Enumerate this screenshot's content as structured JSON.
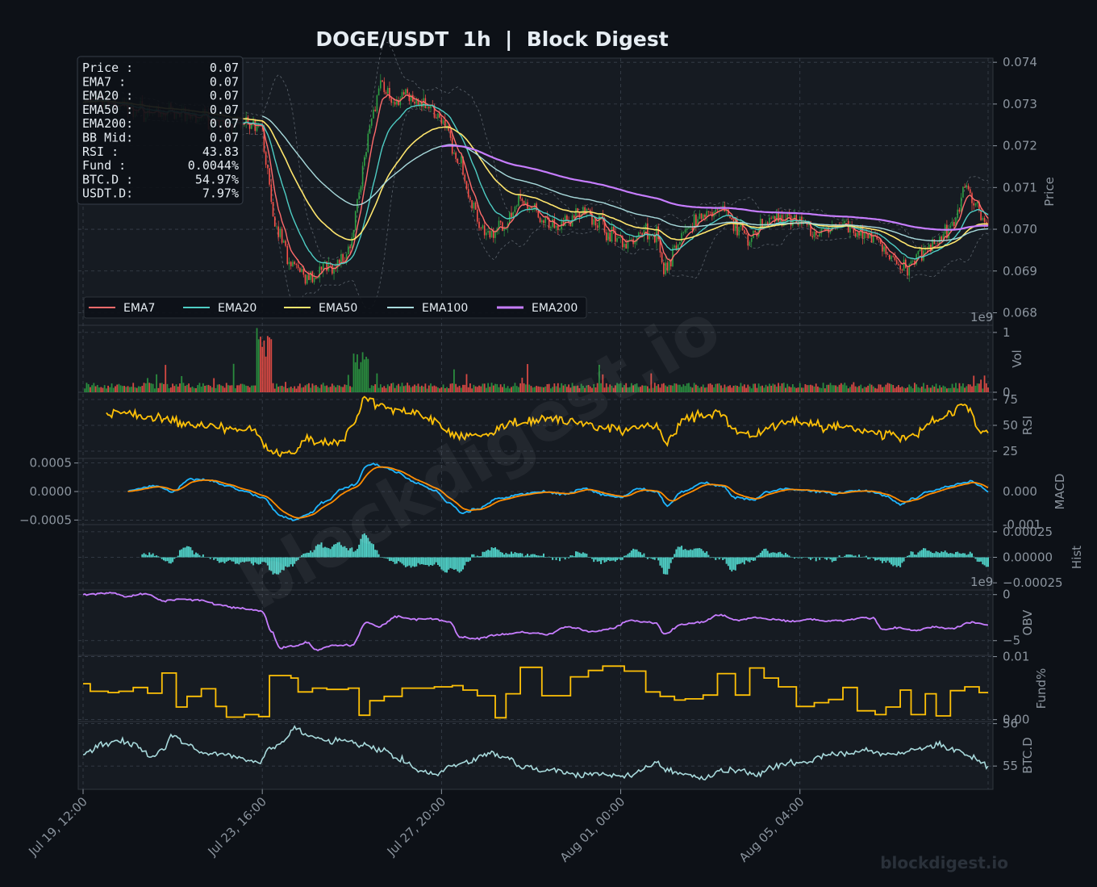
{
  "title": "DOGE/USDT  1h  |  Block Digest",
  "watermark": "blockdigest.io",
  "colors": {
    "background": "#0d1117",
    "panel": "#161b22",
    "grid": "#3a424d",
    "text": "#8b949e",
    "up": "#2ea043",
    "down": "#f85149",
    "ema7": "#ff6b6b",
    "ema20": "#4ecdc4",
    "ema50": "#ffe66d",
    "ema100": "#a8dadc",
    "ema200": "#c77dff",
    "rsi": "#ffc107",
    "macd": "#1fb6ff",
    "signal": "#ff8c00",
    "hist": "#4ecdc4",
    "obv": "#c77dff",
    "funding": "#ffc107",
    "btcd": "#a8dadc"
  },
  "info_box": [
    {
      "label": "Price :",
      "value": "0.07"
    },
    {
      "label": "EMA7  :",
      "value": "0.07"
    },
    {
      "label": "EMA20 :",
      "value": "0.07"
    },
    {
      "label": "EMA50 :",
      "value": "0.07"
    },
    {
      "label": "EMA200:",
      "value": "0.07"
    },
    {
      "label": "BB Mid:",
      "value": "0.07"
    },
    {
      "label": "RSI   :",
      "value": "43.83"
    },
    {
      "label": "Fund  :",
      "value": "0.0044%"
    },
    {
      "label": "BTC.D :",
      "value": "54.97%"
    },
    {
      "label": "USDT.D:",
      "value": "7.97%"
    }
  ],
  "chart_data": {
    "type": "line",
    "x_ticks": [
      "Jul 19, 12:00",
      "Jul 23, 16:00",
      "Jul 27, 20:00",
      "Aug 01, 00:00",
      "Aug 05, 04:00"
    ],
    "x_range_hours": [
      0,
      505
    ],
    "price_anchors": [
      [
        0,
        0.0731
      ],
      [
        40,
        0.0728
      ],
      [
        60,
        0.0727
      ],
      [
        100,
        0.0724
      ],
      [
        102,
        0.0715
      ],
      [
        108,
        0.07
      ],
      [
        116,
        0.0692
      ],
      [
        124,
        0.0688
      ],
      [
        132,
        0.069
      ],
      [
        140,
        0.0692
      ],
      [
        146,
        0.0693
      ],
      [
        150,
        0.0697
      ],
      [
        154,
        0.0708
      ],
      [
        158,
        0.072
      ],
      [
        162,
        0.0728
      ],
      [
        166,
        0.0735
      ],
      [
        170,
        0.0733
      ],
      [
        174,
        0.0731
      ],
      [
        180,
        0.0732
      ],
      [
        186,
        0.073
      ],
      [
        192,
        0.0729
      ],
      [
        200,
        0.0727
      ],
      [
        204,
        0.0722
      ],
      [
        210,
        0.0716
      ],
      [
        216,
        0.0707
      ],
      [
        222,
        0.07
      ],
      [
        228,
        0.0699
      ],
      [
        236,
        0.0702
      ],
      [
        244,
        0.0706
      ],
      [
        250,
        0.0705
      ],
      [
        256,
        0.0703
      ],
      [
        264,
        0.0701
      ],
      [
        272,
        0.0703
      ],
      [
        280,
        0.0704
      ],
      [
        288,
        0.0702
      ],
      [
        296,
        0.0698
      ],
      [
        304,
        0.0697
      ],
      [
        312,
        0.0699
      ],
      [
        320,
        0.0699
      ],
      [
        324,
        0.069
      ],
      [
        330,
        0.0694
      ],
      [
        336,
        0.07
      ],
      [
        344,
        0.0703
      ],
      [
        352,
        0.0704
      ],
      [
        360,
        0.0704
      ],
      [
        366,
        0.07
      ],
      [
        372,
        0.0697
      ],
      [
        378,
        0.0701
      ],
      [
        386,
        0.0703
      ],
      [
        394,
        0.0702
      ],
      [
        402,
        0.0701
      ],
      [
        410,
        0.0699
      ],
      [
        418,
        0.07
      ],
      [
        426,
        0.0701
      ],
      [
        434,
        0.0699
      ],
      [
        442,
        0.0698
      ],
      [
        450,
        0.0694
      ],
      [
        456,
        0.069
      ],
      [
        462,
        0.0691
      ],
      [
        468,
        0.0695
      ],
      [
        474,
        0.0697
      ],
      [
        480,
        0.0699
      ],
      [
        486,
        0.0702
      ],
      [
        490,
        0.0707
      ],
      [
        494,
        0.071
      ],
      [
        498,
        0.0706
      ],
      [
        502,
        0.0703
      ],
      [
        505,
        0.0701
      ]
    ],
    "rsi_anchors": [
      [
        0,
        60
      ],
      [
        20,
        62
      ],
      [
        40,
        58
      ],
      [
        60,
        50
      ],
      [
        80,
        48
      ],
      [
        95,
        45
      ],
      [
        105,
        25
      ],
      [
        115,
        22
      ],
      [
        125,
        35
      ],
      [
        135,
        33
      ],
      [
        145,
        35
      ],
      [
        150,
        50
      ],
      [
        158,
        78
      ],
      [
        165,
        70
      ],
      [
        175,
        65
      ],
      [
        185,
        62
      ],
      [
        195,
        55
      ],
      [
        205,
        42
      ],
      [
        215,
        40
      ],
      [
        225,
        42
      ],
      [
        240,
        52
      ],
      [
        260,
        58
      ],
      [
        270,
        55
      ],
      [
        280,
        50
      ],
      [
        290,
        48
      ],
      [
        300,
        45
      ],
      [
        310,
        48
      ],
      [
        320,
        50
      ],
      [
        325,
        32
      ],
      [
        335,
        55
      ],
      [
        345,
        60
      ],
      [
        355,
        62
      ],
      [
        365,
        45
      ],
      [
        375,
        40
      ],
      [
        385,
        50
      ],
      [
        395,
        55
      ],
      [
        405,
        52
      ],
      [
        415,
        48
      ],
      [
        425,
        50
      ],
      [
        435,
        45
      ],
      [
        445,
        42
      ],
      [
        455,
        38
      ],
      [
        465,
        42
      ],
      [
        475,
        55
      ],
      [
        485,
        62
      ],
      [
        490,
        70
      ],
      [
        495,
        65
      ],
      [
        500,
        45
      ],
      [
        505,
        44
      ]
    ],
    "macd_anchors": [
      [
        25,
        0.0
      ],
      [
        30,
        5e-05
      ],
      [
        40,
        0.0001
      ],
      [
        50,
        0.0
      ],
      [
        60,
        0.00022
      ],
      [
        70,
        0.0002
      ],
      [
        80,
        0.0001
      ],
      [
        90,
        0.0
      ],
      [
        100,
        -0.0001
      ],
      [
        110,
        -0.00042
      ],
      [
        118,
        -0.0005
      ],
      [
        125,
        -0.0004
      ],
      [
        135,
        -0.00018
      ],
      [
        145,
        5e-05
      ],
      [
        152,
        0.00012
      ],
      [
        158,
        0.00044
      ],
      [
        162,
        0.00048
      ],
      [
        168,
        0.00042
      ],
      [
        176,
        0.00032
      ],
      [
        186,
        0.00015
      ],
      [
        196,
        2e-05
      ],
      [
        204,
        -0.0002
      ],
      [
        212,
        -0.00038
      ],
      [
        220,
        -0.0003
      ],
      [
        232,
        -0.00012
      ],
      [
        244,
        -5e-05
      ],
      [
        256,
        0.0
      ],
      [
        268,
        -5e-05
      ],
      [
        280,
        5e-05
      ],
      [
        290,
        -5e-05
      ],
      [
        300,
        -0.0001
      ],
      [
        310,
        5e-05
      ],
      [
        320,
        0.0
      ],
      [
        326,
        -0.00025
      ],
      [
        334,
        0.0
      ],
      [
        346,
        0.00015
      ],
      [
        356,
        0.0001
      ],
      [
        364,
        -0.0001
      ],
      [
        374,
        -0.00015
      ],
      [
        382,
        0.0
      ],
      [
        392,
        5e-05
      ],
      [
        402,
        2e-05
      ],
      [
        412,
        0.0
      ],
      [
        420,
        -4e-05
      ],
      [
        430,
        2e-05
      ],
      [
        440,
        0.0
      ],
      [
        448,
        -8e-05
      ],
      [
        456,
        -0.00022
      ],
      [
        464,
        -0.00012
      ],
      [
        472,
        0.0
      ],
      [
        482,
        8e-05
      ],
      [
        490,
        0.00015
      ],
      [
        496,
        0.00018
      ],
      [
        500,
        0.0001
      ],
      [
        505,
        -1e-05
      ]
    ],
    "obv_anchors": [
      [
        0,
        0.0
      ],
      [
        15,
        0.2
      ],
      [
        25,
        -0.2
      ],
      [
        35,
        0.1
      ],
      [
        45,
        -0.7
      ],
      [
        55,
        -0.5
      ],
      [
        65,
        -0.6
      ],
      [
        75,
        -1.1
      ],
      [
        85,
        -1.4
      ],
      [
        95,
        -1.7
      ],
      [
        100,
        -1.8
      ],
      [
        105,
        -4.0
      ],
      [
        110,
        -5.8
      ],
      [
        118,
        -5.6
      ],
      [
        125,
        -5.2
      ],
      [
        130,
        -6.0
      ],
      [
        140,
        -5.5
      ],
      [
        150,
        -5.5
      ],
      [
        158,
        -3.0
      ],
      [
        165,
        -3.5
      ],
      [
        175,
        -2.4
      ],
      [
        185,
        -2.7
      ],
      [
        195,
        -2.6
      ],
      [
        205,
        -3.0
      ],
      [
        210,
        -4.6
      ],
      [
        220,
        -4.8
      ],
      [
        230,
        -4.4
      ],
      [
        245,
        -4.1
      ],
      [
        260,
        -4.3
      ],
      [
        270,
        -3.5
      ],
      [
        285,
        -4.0
      ],
      [
        295,
        -3.7
      ],
      [
        305,
        -2.8
      ],
      [
        315,
        -3.0
      ],
      [
        320,
        -3.1
      ],
      [
        324,
        -4.3
      ],
      [
        335,
        -3.2
      ],
      [
        345,
        -3.0
      ],
      [
        355,
        -2.2
      ],
      [
        365,
        -2.8
      ],
      [
        375,
        -2.5
      ],
      [
        385,
        -2.7
      ],
      [
        395,
        -2.9
      ],
      [
        405,
        -2.7
      ],
      [
        415,
        -2.9
      ],
      [
        425,
        -2.8
      ],
      [
        435,
        -2.5
      ],
      [
        441,
        -2.6
      ],
      [
        446,
        -3.8
      ],
      [
        455,
        -3.6
      ],
      [
        465,
        -3.9
      ],
      [
        475,
        -3.5
      ],
      [
        485,
        -3.7
      ],
      [
        495,
        -3.0
      ],
      [
        505,
        -3.3
      ]
    ],
    "funding_steps": [
      [
        0,
        0.0057
      ],
      [
        4,
        0.0045
      ],
      [
        14,
        0.0043
      ],
      [
        20,
        0.0045
      ],
      [
        28,
        0.0051
      ],
      [
        36,
        0.0042
      ],
      [
        44,
        0.0074
      ],
      [
        52,
        0.002
      ],
      [
        58,
        0.0037
      ],
      [
        66,
        0.0049
      ],
      [
        74,
        0.0021
      ],
      [
        80,
        0.0004
      ],
      [
        90,
        0.0008
      ],
      [
        98,
        0.0005
      ],
      [
        104,
        0.007
      ],
      [
        116,
        0.0066
      ],
      [
        120,
        0.0044
      ],
      [
        128,
        0.005
      ],
      [
        136,
        0.0048
      ],
      [
        148,
        0.005
      ],
      [
        154,
        0.0007
      ],
      [
        160,
        0.003
      ],
      [
        168,
        0.0037
      ],
      [
        178,
        0.005
      ],
      [
        196,
        0.0052
      ],
      [
        206,
        0.0054
      ],
      [
        212,
        0.0047
      ],
      [
        220,
        0.0038
      ],
      [
        230,
        0.0003
      ],
      [
        236,
        0.0041
      ],
      [
        244,
        0.0083
      ],
      [
        256,
        0.0038
      ],
      [
        264,
        0.0038
      ],
      [
        272,
        0.0068
      ],
      [
        282,
        0.0078
      ],
      [
        290,
        0.0085
      ],
      [
        302,
        0.0077
      ],
      [
        314,
        0.0044
      ],
      [
        322,
        0.0037
      ],
      [
        330,
        0.0031
      ],
      [
        336,
        0.0033
      ],
      [
        346,
        0.0039
      ],
      [
        354,
        0.0073
      ],
      [
        364,
        0.0039
      ],
      [
        372,
        0.0082
      ],
      [
        380,
        0.0066
      ],
      [
        388,
        0.0052
      ],
      [
        398,
        0.0021
      ],
      [
        408,
        0.0027
      ],
      [
        416,
        0.0032
      ],
      [
        424,
        0.0051
      ],
      [
        432,
        0.0014
      ],
      [
        442,
        0.0008
      ],
      [
        448,
        0.002
      ],
      [
        456,
        0.0047
      ],
      [
        462,
        0.0008
      ],
      [
        470,
        0.0041
      ],
      [
        476,
        0.0006
      ],
      [
        484,
        0.0046
      ],
      [
        492,
        0.0052
      ],
      [
        500,
        0.0043
      ],
      [
        505,
        0.0043
      ]
    ],
    "btcd_anchors": [
      [
        0,
        55.3
      ],
      [
        10,
        55.5
      ],
      [
        20,
        55.6
      ],
      [
        30,
        55.5
      ],
      [
        38,
        55.2
      ],
      [
        44,
        55.4
      ],
      [
        50,
        55.7
      ],
      [
        58,
        55.5
      ],
      [
        66,
        55.3
      ],
      [
        76,
        55.3
      ],
      [
        86,
        55.2
      ],
      [
        98,
        55.1
      ],
      [
        104,
        55.4
      ],
      [
        112,
        55.6
      ],
      [
        118,
        55.9
      ],
      [
        126,
        55.7
      ],
      [
        136,
        55.6
      ],
      [
        146,
        55.6
      ],
      [
        156,
        55.5
      ],
      [
        166,
        55.4
      ],
      [
        176,
        55.2
      ],
      [
        186,
        54.9
      ],
      [
        196,
        54.8
      ],
      [
        206,
        55.0
      ],
      [
        216,
        55.1
      ],
      [
        226,
        55.3
      ],
      [
        236,
        55.2
      ],
      [
        246,
        55.0
      ],
      [
        256,
        54.9
      ],
      [
        266,
        54.9
      ],
      [
        276,
        54.8
      ],
      [
        286,
        54.8
      ],
      [
        296,
        54.8
      ],
      [
        306,
        54.8
      ],
      [
        316,
        55.0
      ],
      [
        320,
        55.1
      ],
      [
        326,
        54.9
      ],
      [
        336,
        54.8
      ],
      [
        346,
        54.7
      ],
      [
        356,
        54.9
      ],
      [
        366,
        54.9
      ],
      [
        376,
        54.8
      ],
      [
        386,
        55.0
      ],
      [
        396,
        55.1
      ],
      [
        406,
        55.1
      ],
      [
        416,
        55.3
      ],
      [
        426,
        55.3
      ],
      [
        436,
        55.4
      ],
      [
        446,
        55.3
      ],
      [
        456,
        55.3
      ],
      [
        466,
        55.4
      ],
      [
        476,
        55.5
      ],
      [
        486,
        55.4
      ],
      [
        496,
        55.2
      ],
      [
        505,
        55.0
      ]
    ],
    "panels": [
      {
        "id": "price",
        "ylabel": "Price",
        "ylim": [
          0.0677,
          0.0741
        ],
        "ticks": [
          "0.068",
          "0.069",
          "0.070",
          "0.071",
          "0.072",
          "0.073",
          "0.074"
        ],
        "offset_text": "1e9",
        "legend": [
          "EMA7",
          "EMA20",
          "EMA50",
          "EMA100",
          "EMA200"
        ]
      },
      {
        "id": "volume",
        "ylabel": "Vol",
        "ylim": [
          0,
          1.12
        ],
        "ticks": [
          "0",
          "1"
        ]
      },
      {
        "id": "rsi",
        "ylabel": "RSI",
        "ylim": [
          18,
          82
        ],
        "ticks": [
          "25",
          "50",
          "75"
        ]
      },
      {
        "id": "macd",
        "ylabel": "MACD",
        "ylim": [
          -0.00058,
          0.00058
        ],
        "ticks_right": [
          "-0.001",
          "0.000"
        ],
        "ticks_left": [
          "−0.0005",
          "0.0000",
          "0.0005"
        ]
      },
      {
        "id": "hist",
        "ylabel": "Hist",
        "ylim": [
          -0.00032,
          0.00032
        ],
        "ticks": [
          "−0.00025",
          "0.00000",
          "0.00025"
        ],
        "offset_text": "1e9"
      },
      {
        "id": "obv",
        "ylabel": "OBV",
        "ylim": [
          -6.6,
          0.5
        ],
        "ticks": [
          "−5",
          "0"
        ]
      },
      {
        "id": "funding",
        "ylabel": "Fund%",
        "ylim": [
          -0.0003,
          0.0102
        ],
        "ticks": [
          "0.00",
          "0.01"
        ]
      },
      {
        "id": "btcd",
        "ylabel": "BTC.D",
        "ylim": [
          54.45,
          56.05
        ],
        "ticks": [
          "55",
          "56"
        ]
      }
    ]
  }
}
